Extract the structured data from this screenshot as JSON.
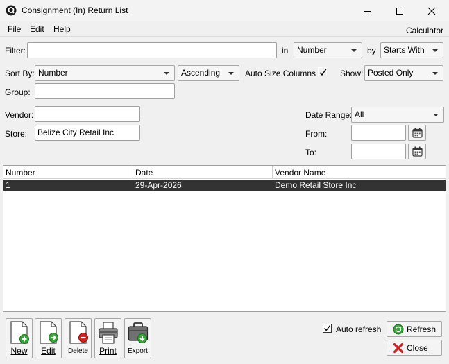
{
  "window": {
    "title": "Consignment (In) Return List"
  },
  "menu": {
    "file": "File",
    "edit": "Edit",
    "help": "Help",
    "calculator": "Calculator"
  },
  "filter": {
    "label": "Filter:",
    "value": "",
    "in_label": "in",
    "in_value": "Number",
    "by_label": "by",
    "by_value": "Starts With"
  },
  "sort": {
    "label": "Sort By:",
    "field_value": "Number",
    "order_value": "Ascending",
    "auto_size_label": "Auto Size Columns",
    "auto_size_checked": true,
    "show_label": "Show:",
    "show_value": "Posted Only"
  },
  "group": {
    "label": "Group:",
    "value": ""
  },
  "vendor": {
    "label": "Vendor:",
    "value": ""
  },
  "store": {
    "label": "Store:",
    "value": "Belize City Retail Inc"
  },
  "date_range": {
    "label": "Date Range:",
    "value": "All",
    "from_label": "From:",
    "from_value": "",
    "to_label": "To:",
    "to_value": ""
  },
  "table": {
    "columns": [
      "Number",
      "Date",
      "Vendor Name"
    ],
    "rows": [
      {
        "number": "1",
        "date": "29-Apr-2026",
        "vendor": "Demo Retail Store Inc"
      }
    ]
  },
  "toolbar": {
    "new": "New",
    "edit": "Edit",
    "delete": "Delete",
    "print": "Print",
    "export": "Export"
  },
  "actions": {
    "auto_refresh_label": "Auto refresh",
    "auto_refresh_checked": true,
    "refresh": "Refresh",
    "close": "Close"
  },
  "colors": {
    "selected_row": "#333333",
    "accent_green": "#3aa33a",
    "accent_red": "#d42020"
  }
}
